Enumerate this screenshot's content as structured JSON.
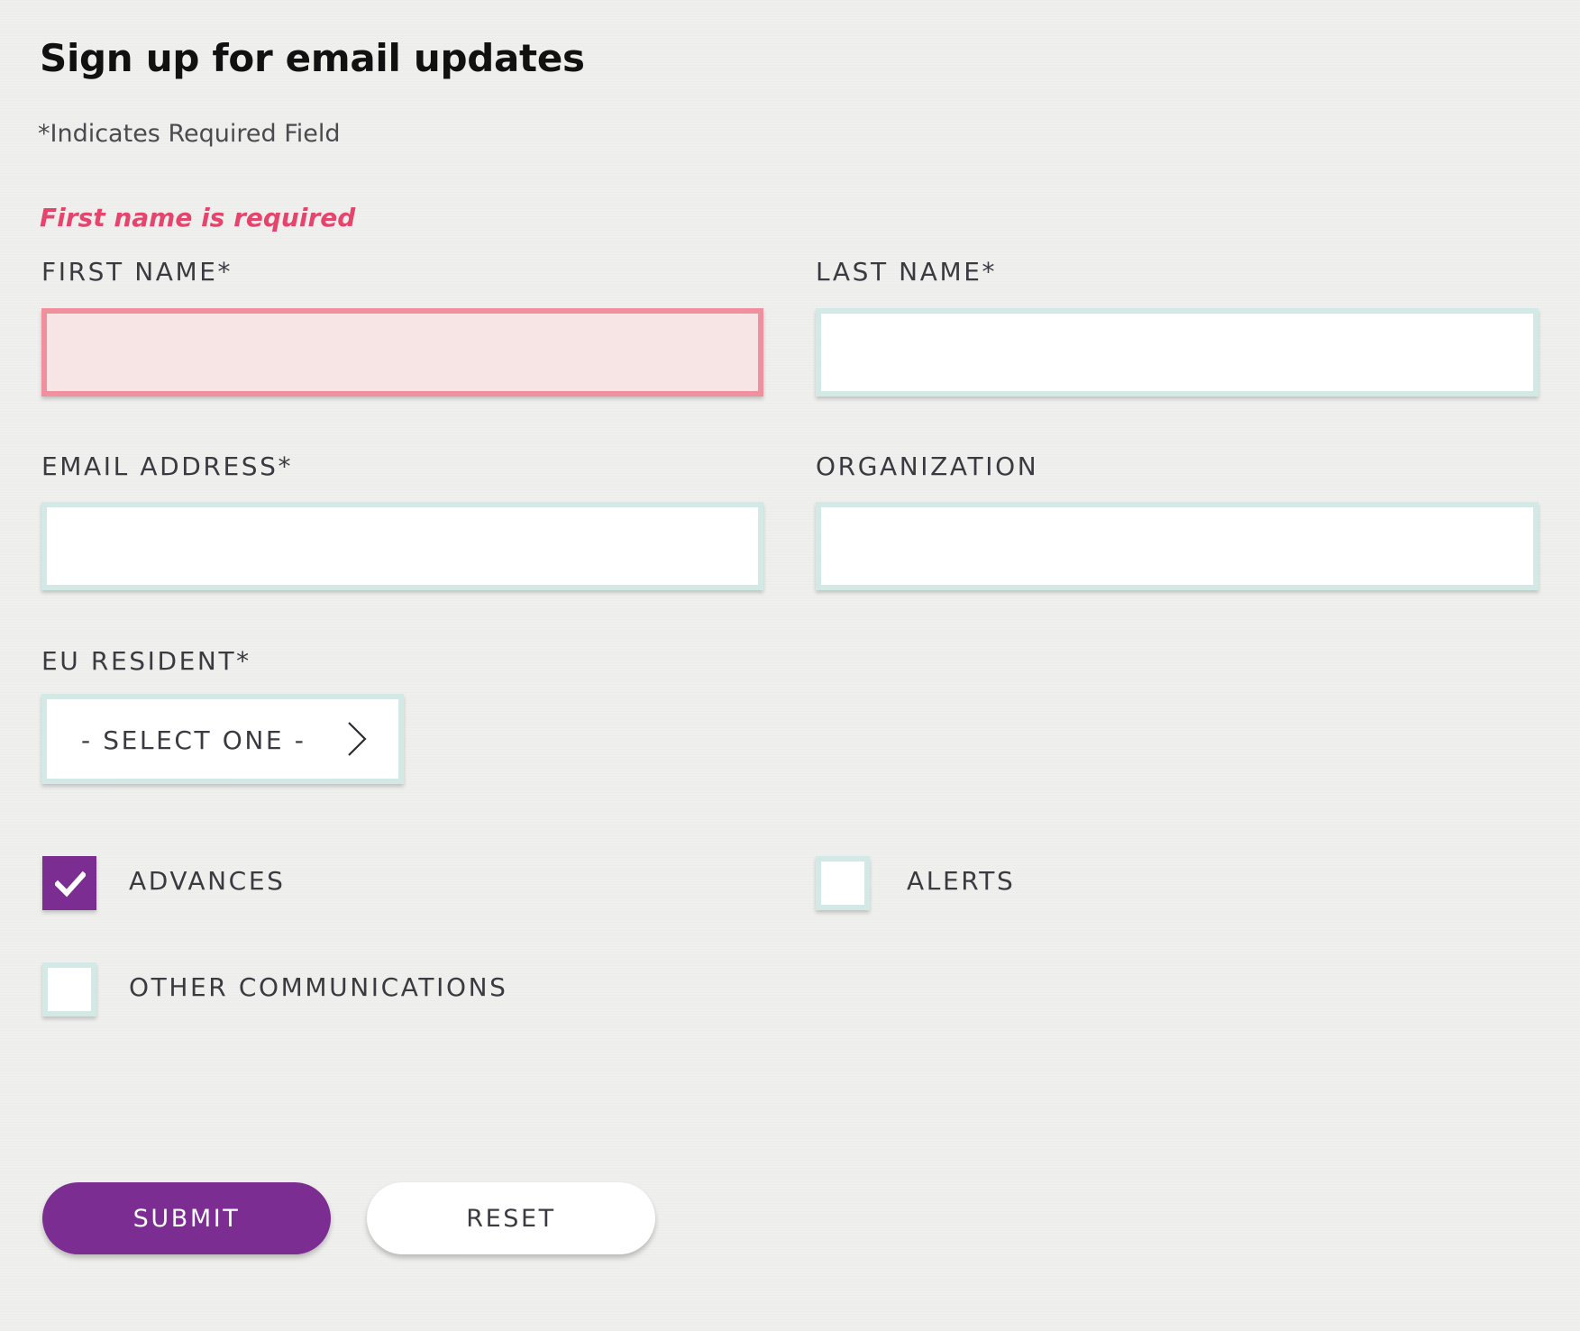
{
  "form": {
    "title": "Sign up for email updates",
    "required_note": "*Indicates Required Field",
    "error_message": "First name is required"
  },
  "fields": {
    "first_name": {
      "label": "FIRST NAME*",
      "value": "",
      "state": "error"
    },
    "last_name": {
      "label": "LAST NAME*",
      "value": ""
    },
    "email": {
      "label": "EMAIL ADDRESS*",
      "value": ""
    },
    "organization": {
      "label": "ORGANIZATION",
      "value": ""
    },
    "eu_resident": {
      "label": "EU RESIDENT*",
      "selected": "- SELECT ONE -"
    }
  },
  "subscriptions": {
    "advances": {
      "label": "ADVANCES",
      "checked": true
    },
    "alerts": {
      "label": "ALERTS",
      "checked": false
    },
    "other": {
      "label": "OTHER COMMUNICATIONS",
      "checked": false
    }
  },
  "buttons": {
    "submit": "SUBMIT",
    "reset": "RESET"
  },
  "icons": {
    "select_chevron": "chevron-right-icon",
    "checkmark": "check-icon"
  },
  "colors": {
    "accent": "#7b2d91",
    "error_text": "#e5446d",
    "error_border": "#f08f9d",
    "error_fill": "#f7e5e6",
    "input_border": "#d2e9e6",
    "background": "#efefee"
  }
}
